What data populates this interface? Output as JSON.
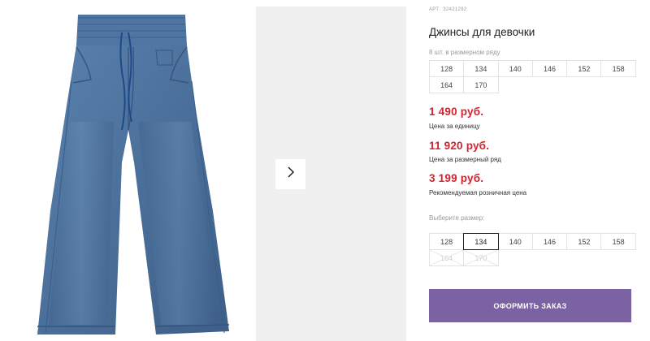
{
  "product": {
    "art_label": "АРТ:",
    "art_number": "32421292",
    "title": "Джинсы для девочки",
    "row_note": "8 шт. в размерном ряду",
    "row_sizes": [
      "128",
      "134",
      "140",
      "146",
      "152",
      "158",
      "164",
      "170"
    ]
  },
  "prices": {
    "unit_price": "1 490 руб.",
    "unit_label": "Цена за единицу",
    "row_price": "11 920 руб.",
    "row_label": "Цена за размерный ряд",
    "retail_price": "3 199 руб.",
    "retail_label": "Рекомендуемая розничная цена"
  },
  "size_select": {
    "label": "Выберите размер:",
    "sizes": [
      {
        "value": "128",
        "state": "available"
      },
      {
        "value": "134",
        "state": "selected"
      },
      {
        "value": "140",
        "state": "available"
      },
      {
        "value": "146",
        "state": "available"
      },
      {
        "value": "152",
        "state": "available"
      },
      {
        "value": "158",
        "state": "available"
      },
      {
        "value": "164",
        "state": "disabled"
      },
      {
        "value": "170",
        "state": "disabled"
      }
    ]
  },
  "order_button": "ОФОРМИТЬ ЗАКАЗ",
  "gallery": {
    "next_icon": "chevron-right-icon"
  },
  "colors": {
    "price_red": "#d6212d",
    "button_purple": "#7b63a3",
    "denim": "#4a6f9a"
  }
}
